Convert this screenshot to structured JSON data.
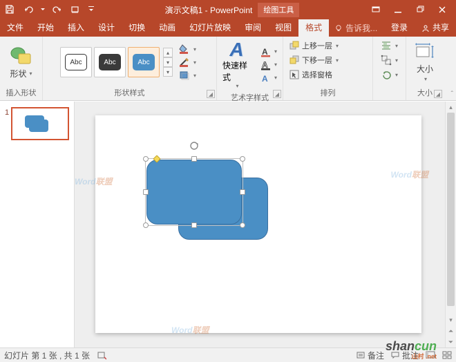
{
  "title": {
    "doc": "演示文稿1 - PowerPoint",
    "context_tab": "绘图工具"
  },
  "tabs": {
    "file": "文件",
    "home": "开始",
    "insert": "插入",
    "design": "设计",
    "transitions": "切换",
    "animations": "动画",
    "slideshow": "幻灯片放映",
    "review": "审阅",
    "view": "视图",
    "format": "格式"
  },
  "tell_me": "告诉我...",
  "login": "登录",
  "share": "共享",
  "ribbon": {
    "insert_shape": {
      "label": "形状",
      "group": "插入形状"
    },
    "shape_styles": {
      "group": "形状样式",
      "abc": "Abc"
    },
    "wordart": {
      "label": "快速样式",
      "group": "艺术字样式"
    },
    "arrange": {
      "bring_forward": "上移一层",
      "send_backward": "下移一层",
      "selection_pane": "选择窗格",
      "group": "排列"
    },
    "size": {
      "label": "大小",
      "group": "大小"
    }
  },
  "thumb": {
    "num": "1"
  },
  "status": {
    "slide_info": "幻灯片 第 1 张 , 共 1 张",
    "lang": "",
    "notes": "备注",
    "comments": "批注"
  }
}
